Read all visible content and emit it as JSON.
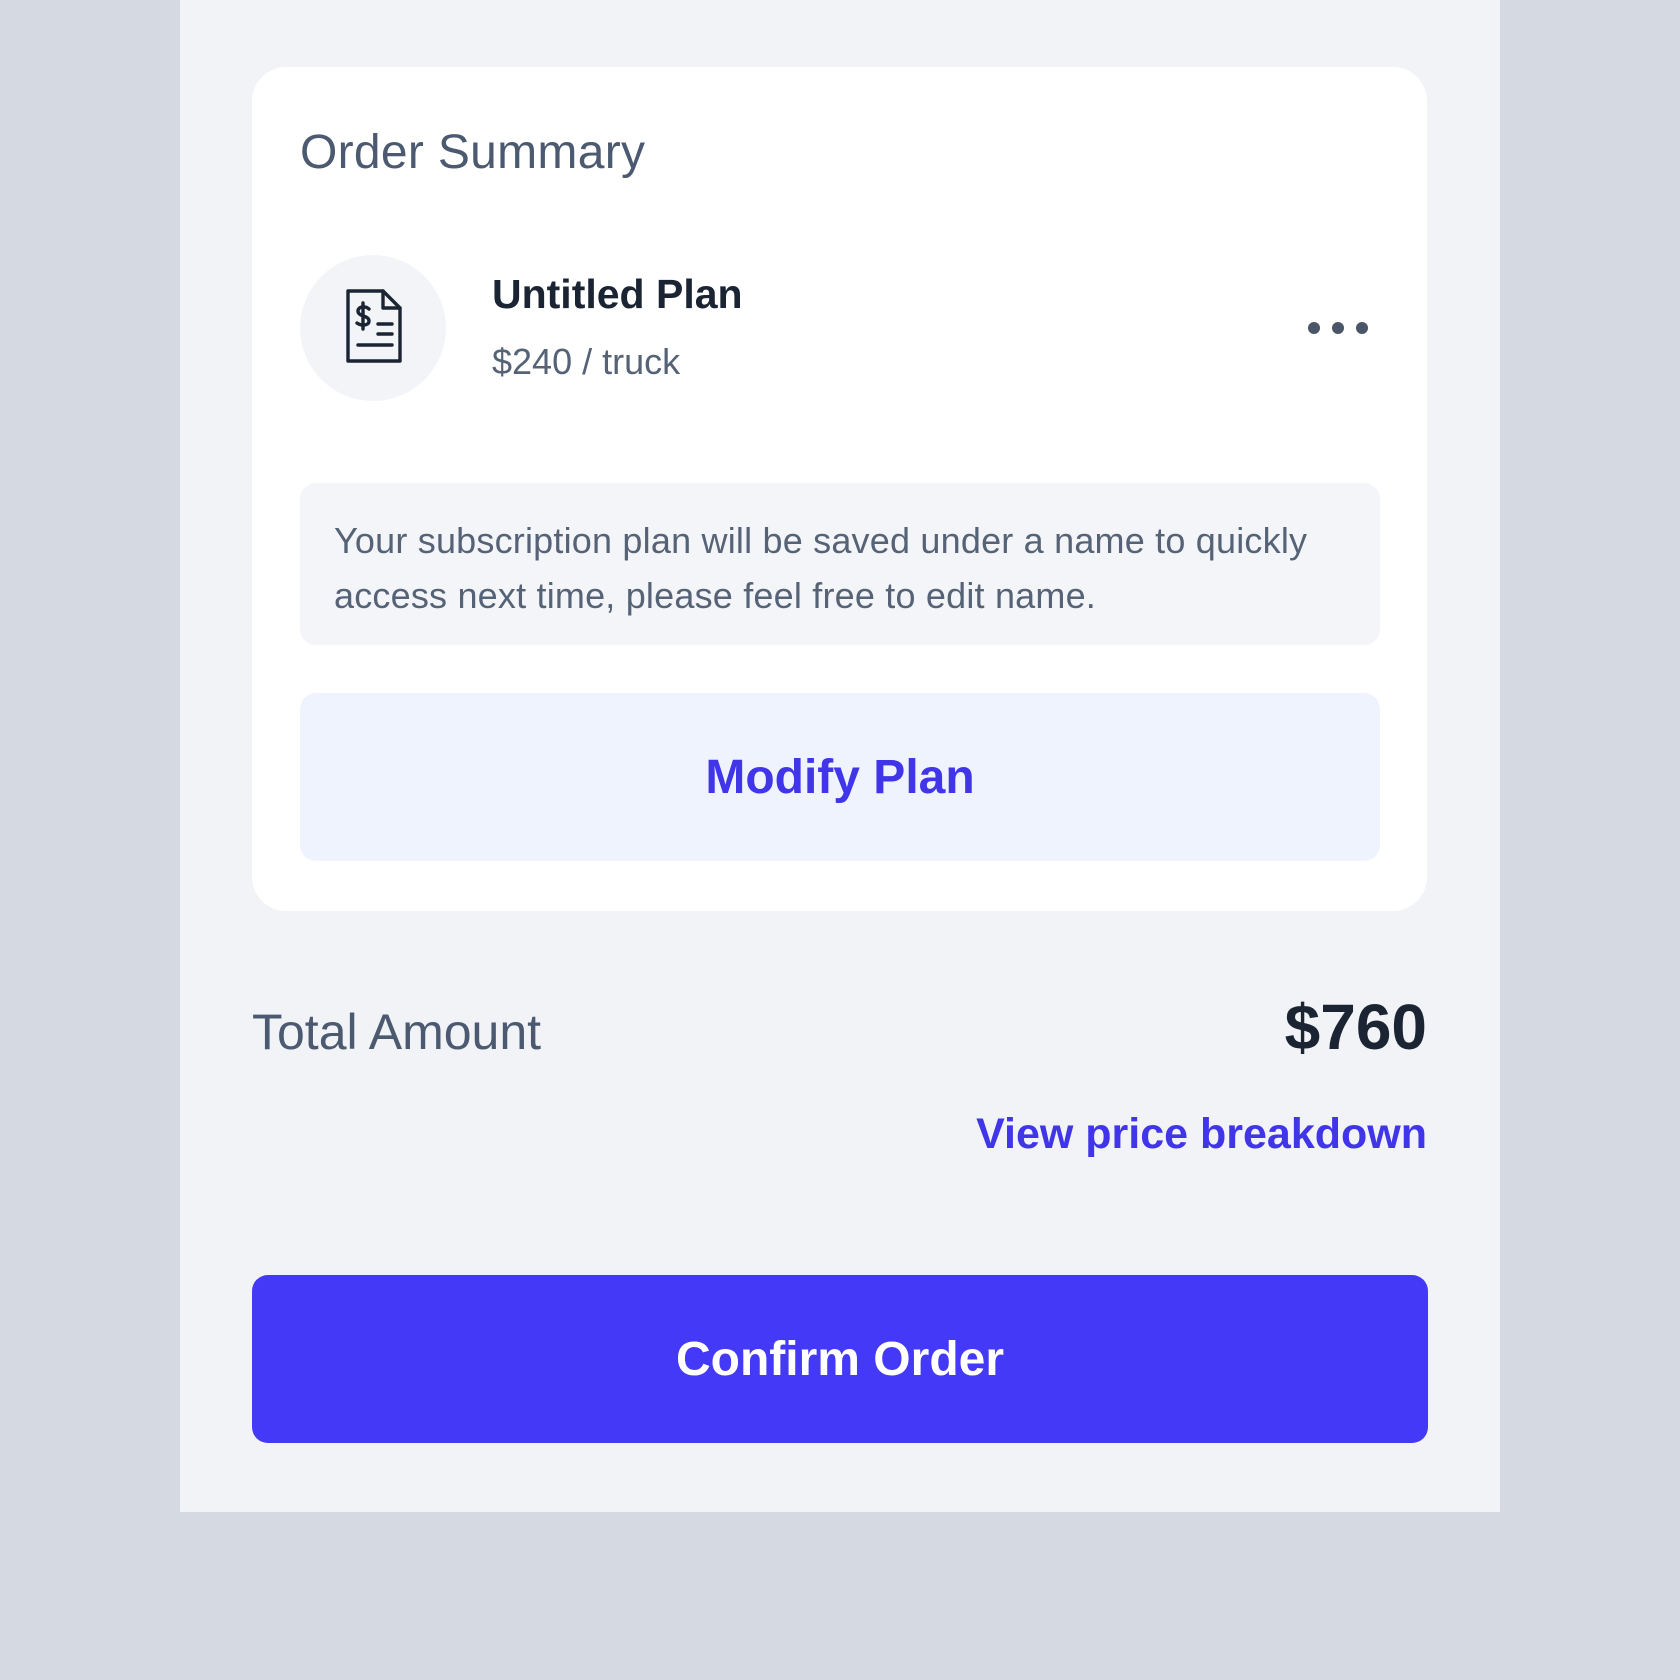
{
  "order_summary": {
    "title": "Order Summary",
    "plan": {
      "icon": "invoice-document-icon",
      "name": "Untitled Plan",
      "price": "$240 / truck",
      "more_icon": "more-horizontal-icon"
    },
    "info_text": "Your subscription plan will be saved under a name to quickly access next time, please feel free to edit name.",
    "modify_label": "Modify Plan"
  },
  "total": {
    "label": "Total Amount",
    "value": "$760",
    "breakdown_link": "View price breakdown"
  },
  "confirm_label": "Confirm Order",
  "colors": {
    "accent": "#4339f6",
    "accent_text": "#4135ea",
    "modify_bg": "#eef3fd",
    "screen_bg": "#f1f3f6",
    "outer_bg": "#d5d9e1"
  }
}
